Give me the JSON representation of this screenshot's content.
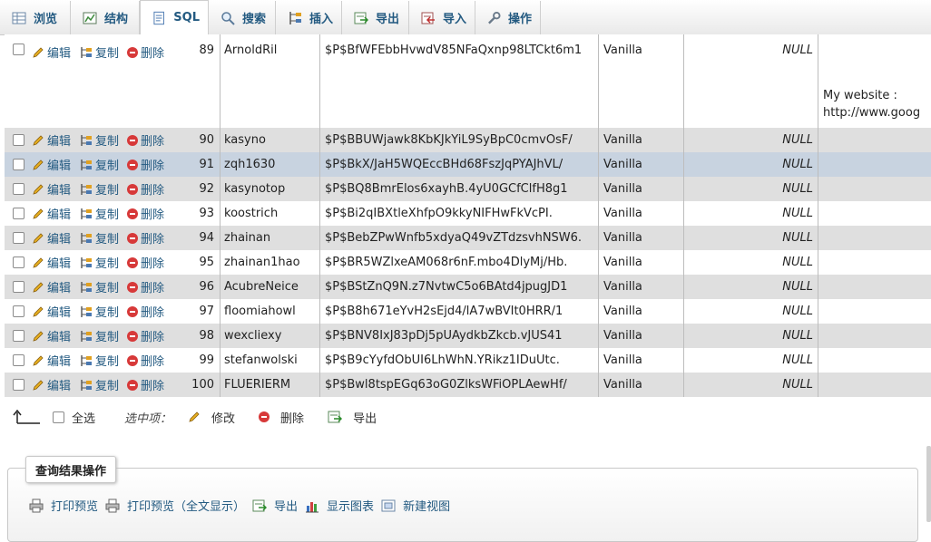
{
  "tabs": [
    {
      "label": "浏览",
      "icon": "browse-icon"
    },
    {
      "label": "结构",
      "icon": "structure-icon"
    },
    {
      "label": "SQL",
      "icon": "sql-icon"
    },
    {
      "label": "搜索",
      "icon": "search-icon"
    },
    {
      "label": "插入",
      "icon": "insert-icon"
    },
    {
      "label": "导出",
      "icon": "export-icon"
    },
    {
      "label": "导入",
      "icon": "import-icon"
    },
    {
      "label": "操作",
      "icon": "wrench-icon"
    }
  ],
  "row_actions": {
    "edit": "编辑",
    "copy": "复制",
    "delete": "删除"
  },
  "rows": [
    {
      "id": "89",
      "name": "ArnoldRil",
      "password": "$P$BfWFEbbHvwdV85NFaQxnp98LTCkt6m1",
      "group": "Vanilla",
      "value": "NULL",
      "website_1": "My website :",
      "website_2": "http://www.goog"
    },
    {
      "id": "90",
      "name": "kasyno",
      "password": "$P$BBUWjawk8KbKJkYiL9SyBpC0cmvOsF/",
      "group": "Vanilla",
      "value": "NULL"
    },
    {
      "id": "91",
      "name": "zqh1630",
      "password": "$P$BkX/JaH5WQEccBHd68FszJqPYAJhVL/",
      "group": "Vanilla",
      "value": "NULL"
    },
    {
      "id": "92",
      "name": "kasynotop",
      "password": "$P$BQ8BmrElos6xayhB.4yU0GCfClfH8g1",
      "group": "Vanilla",
      "value": "NULL"
    },
    {
      "id": "93",
      "name": "koostrich",
      "password": "$P$Bi2qIBXtleXhfpO9kkyNIFHwFkVcPI.",
      "group": "Vanilla",
      "value": "NULL"
    },
    {
      "id": "94",
      "name": "zhainan",
      "password": "$P$BebZPwWnfb5xdyaQ49vZTdzsvhNSW6.",
      "group": "Vanilla",
      "value": "NULL"
    },
    {
      "id": "95",
      "name": "zhainan1hao",
      "password": "$P$BR5WZlxeAM068r6nF.mbo4DlyMj/Hb.",
      "group": "Vanilla",
      "value": "NULL"
    },
    {
      "id": "96",
      "name": "AcubreNeice",
      "password": "$P$BStZnQ9N.z7NvtwC5o6BAtd4jpugJD1",
      "group": "Vanilla",
      "value": "NULL"
    },
    {
      "id": "97",
      "name": "floomiahowl",
      "password": "$P$B8h671eYvH2sEjd4/lA7wBVIt0HRR/1",
      "group": "Vanilla",
      "value": "NULL"
    },
    {
      "id": "98",
      "name": "wexcliexy",
      "password": "$P$BNV8IxJ83pDj5pUAydkbZkcb.vJUS41",
      "group": "Vanilla",
      "value": "NULL"
    },
    {
      "id": "99",
      "name": "stefanwolski",
      "password": "$P$B9cYyfdObUI6LhWhN.YRikz1IDuUtc.",
      "group": "Vanilla",
      "value": "NULL"
    },
    {
      "id": "100",
      "name": "FLUERIERM",
      "password": "$P$Bwl8tspEGq63oG0ZlksWFiOPLAewHf/",
      "group": "Vanilla",
      "value": "NULL"
    }
  ],
  "bulk": {
    "select_all": "全选",
    "with_selected": "选中项：",
    "edit": "修改",
    "delete": "删除",
    "export": "导出"
  },
  "query_ops": {
    "title": "查询结果操作",
    "items": [
      {
        "label": "打印预览",
        "icon": "printer-icon"
      },
      {
        "label": "打印预览（全文显示）",
        "icon": "printer-icon"
      },
      {
        "label": "导出",
        "icon": "export-icon"
      },
      {
        "label": "显示图表",
        "icon": "chart-icon"
      },
      {
        "label": "新建视图",
        "icon": "view-icon"
      }
    ]
  }
}
